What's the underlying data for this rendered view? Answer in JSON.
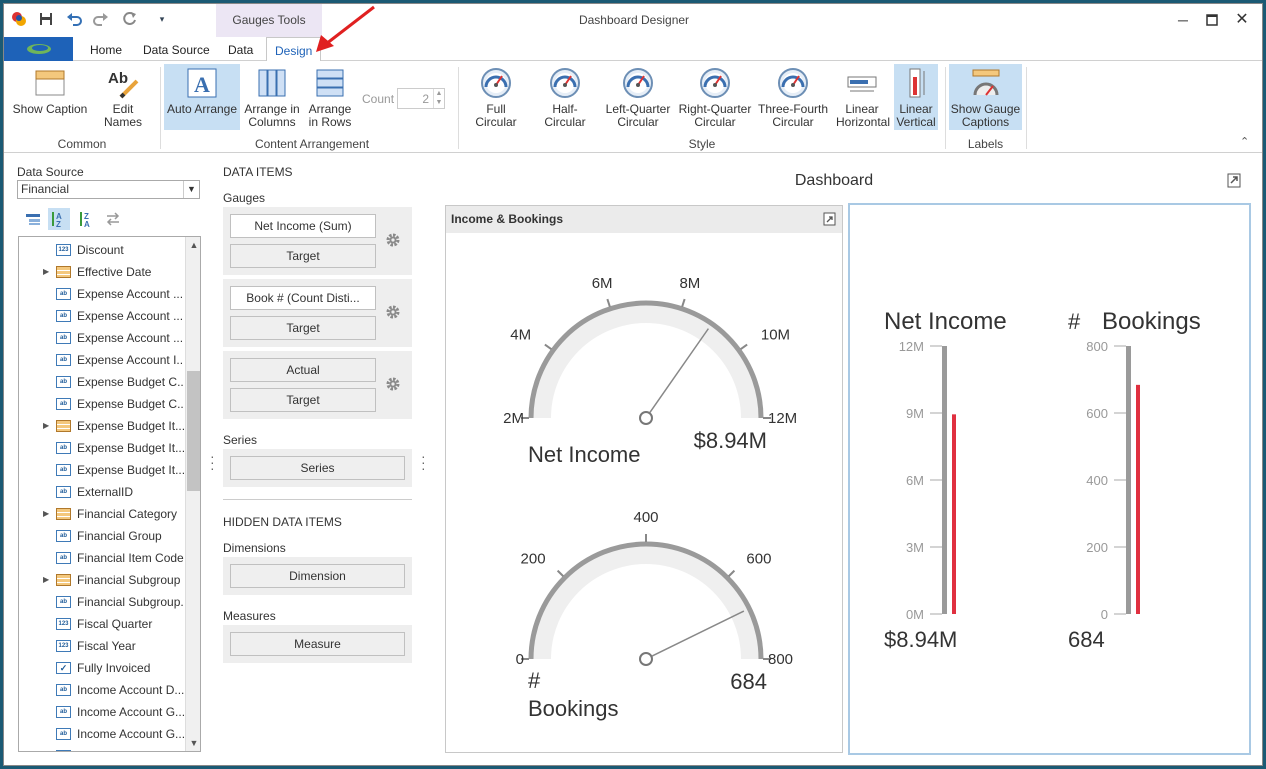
{
  "window": {
    "title": "Dashboard Designer",
    "context_tab": "Gauges Tools"
  },
  "quick_access": {
    "icons": [
      "app-icon",
      "save-icon",
      "undo-icon",
      "redo-icon",
      "refresh-icon",
      "customize-icon"
    ]
  },
  "tabs": [
    "Home",
    "Data Source",
    "Data",
    "Design"
  ],
  "active_tab": "Design",
  "ribbon": {
    "common": {
      "label": "Common",
      "show_caption": "Show Caption",
      "edit_names": "Edit Names"
    },
    "content_arrangement": {
      "label": "Content Arrangement",
      "auto_arrange": "Auto Arrange",
      "arrange_columns_1": "Arrange in",
      "arrange_columns_2": "Columns",
      "arrange_rows_1": "Arrange",
      "arrange_rows_2": "in Rows",
      "count_label": "Count",
      "count_value": "2"
    },
    "style": {
      "label": "Style",
      "items": [
        {
          "l1": "Full Circular",
          "l2": ""
        },
        {
          "l1": "Half-Circular",
          "l2": ""
        },
        {
          "l1": "Left-Quarter",
          "l2": "Circular"
        },
        {
          "l1": "Right-Quarter",
          "l2": "Circular"
        },
        {
          "l1": "Three-Fourth",
          "l2": "Circular"
        },
        {
          "l1": "Linear",
          "l2": "Horizontal"
        },
        {
          "l1": "Linear",
          "l2": "Vertical"
        }
      ],
      "selected": "Linear Vertical"
    },
    "labels": {
      "label": "Labels",
      "show_gauge_captions_1": "Show Gauge",
      "show_gauge_captions_2": "Captions"
    }
  },
  "data_source": {
    "label": "Data Source",
    "selected": "Financial",
    "fields": [
      {
        "name": "Discount",
        "type": "num",
        "expandable": false
      },
      {
        "name": "Effective Date",
        "type": "table",
        "expandable": true
      },
      {
        "name": "Expense Account ...",
        "type": "ab",
        "expandable": false
      },
      {
        "name": "Expense Account ...",
        "type": "ab",
        "expandable": false
      },
      {
        "name": "Expense Account ...",
        "type": "ab",
        "expandable": false
      },
      {
        "name": "Expense Account I...",
        "type": "ab",
        "expandable": false
      },
      {
        "name": "Expense Budget C...",
        "type": "ab",
        "expandable": false
      },
      {
        "name": "Expense Budget C...",
        "type": "ab",
        "expandable": false
      },
      {
        "name": "Expense Budget It...",
        "type": "table",
        "expandable": true
      },
      {
        "name": "Expense Budget It...",
        "type": "ab",
        "expandable": false
      },
      {
        "name": "Expense Budget It...",
        "type": "ab",
        "expandable": false
      },
      {
        "name": "ExternalID",
        "type": "ab",
        "expandable": false
      },
      {
        "name": "Financial Category",
        "type": "table",
        "expandable": true
      },
      {
        "name": "Financial Group",
        "type": "ab",
        "expandable": false
      },
      {
        "name": "Financial Item Code",
        "type": "ab",
        "expandable": false
      },
      {
        "name": "Financial Subgroup",
        "type": "table",
        "expandable": true
      },
      {
        "name": "Financial Subgroup...",
        "type": "ab",
        "expandable": false
      },
      {
        "name": "Fiscal Quarter",
        "type": "num",
        "expandable": false
      },
      {
        "name": "Fiscal Year",
        "type": "num",
        "expandable": false
      },
      {
        "name": "Fully Invoiced",
        "type": "check",
        "expandable": false
      },
      {
        "name": "Income Account D...",
        "type": "ab",
        "expandable": false
      },
      {
        "name": "Income Account G...",
        "type": "ab",
        "expandable": false
      },
      {
        "name": "Income Account G...",
        "type": "ab",
        "expandable": false
      },
      {
        "name": "Income Account I...",
        "type": "ab",
        "expandable": false
      }
    ]
  },
  "data_items": {
    "header": "DATA ITEMS",
    "gauges_label": "Gauges",
    "gauges": [
      {
        "actual": "Net Income (Sum)",
        "target": "Target"
      },
      {
        "actual": "Book # (Count Disti...",
        "target": "Target"
      },
      {
        "actual": "Actual",
        "target": "Target"
      }
    ],
    "series_label": "Series",
    "series_slot": "Series",
    "hidden_header": "HIDDEN DATA ITEMS",
    "dimensions_label": "Dimensions",
    "dimension_slot": "Dimension",
    "measures_label": "Measures",
    "measure_slot": "Measure"
  },
  "dashboard": {
    "title": "Dashboard",
    "panel1_caption": "Income & Bookings",
    "gauge1": {
      "caption": "Net Income",
      "value_label": "$8.94M",
      "value": 8.94,
      "min": 2,
      "max": 12,
      "ticks": [
        "2M",
        "4M",
        "6M",
        "8M",
        "10M",
        "12M"
      ]
    },
    "gauge2": {
      "caption_1": "#",
      "caption_2": "Bookings",
      "value_label": "684",
      "value": 684,
      "min": 0,
      "max": 800,
      "ticks": [
        "0",
        "200",
        "400",
        "600",
        "800"
      ]
    },
    "linear1": {
      "caption": "Net Income",
      "value_label": "$8.94M",
      "value": 8.94,
      "max": 12,
      "ticks": [
        "0M",
        "3M",
        "6M",
        "9M",
        "12M"
      ]
    },
    "linear2": {
      "caption_1": "#",
      "caption_2": "Bookings",
      "value_label": "684",
      "value": 684,
      "max": 800,
      "ticks": [
        "0",
        "200",
        "400",
        "600",
        "800"
      ]
    }
  },
  "colors": {
    "accent": "#1e62b8",
    "needle_bar": "#e03040",
    "selected_ribbon": "#c7dff3",
    "arrow": "#e02020"
  }
}
